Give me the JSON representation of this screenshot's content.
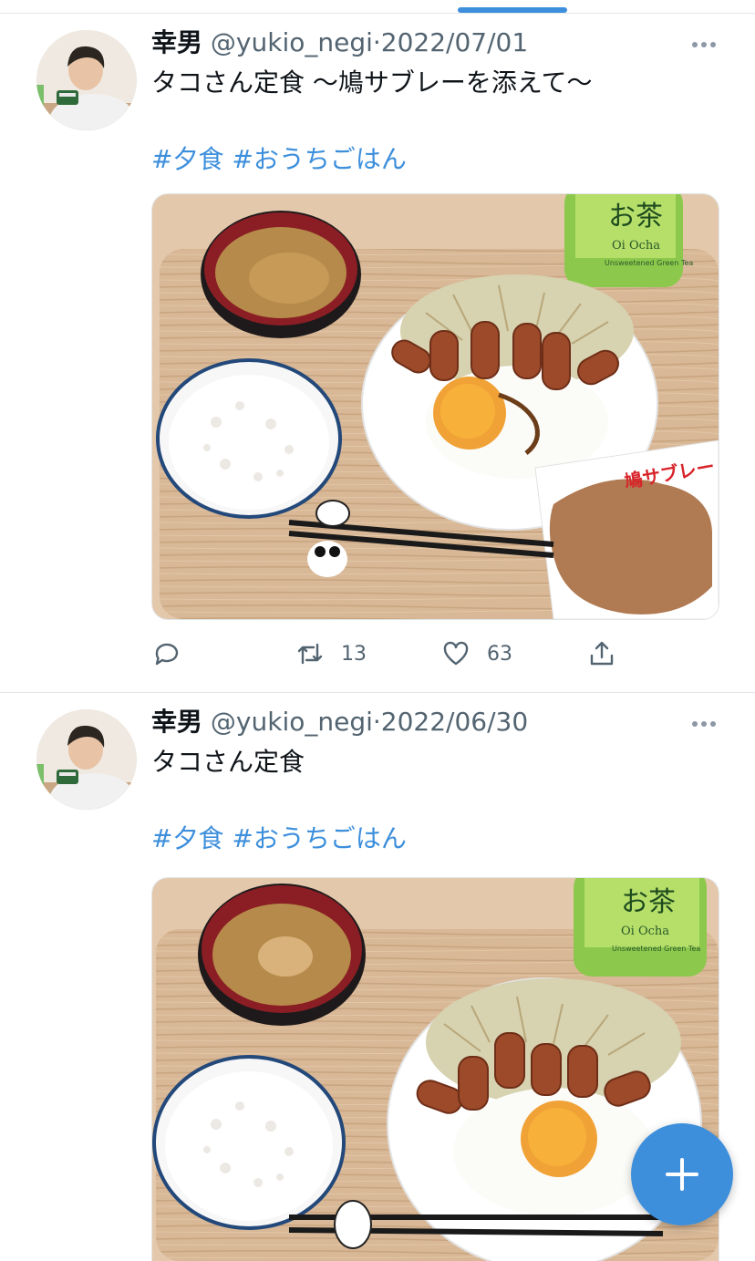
{
  "tweets": [
    {
      "name": "幸男",
      "handle": "@yukio_negi",
      "dot": "·",
      "date": "2022/07/01",
      "text": "タコさん定食 〜鳩サブレーを添えて〜",
      "tags": [
        "#夕食",
        "#おうちごはん"
      ],
      "media_labels": [
        "お茶",
        "Oi Ocha",
        "Unsweetened Green Tea",
        "鳩サブレー"
      ],
      "retweets": "13",
      "likes": "63"
    },
    {
      "name": "幸男",
      "handle": "@yukio_negi",
      "dot": "·",
      "date": "2022/06/30",
      "text": "タコさん定食",
      "tags": [
        "#夕食",
        "#おうちごはん"
      ],
      "media_labels": [
        "お茶",
        "Oi Ocha",
        "Unsweetened Green Tea"
      ]
    }
  ],
  "icons": {
    "more": "more-dots-icon",
    "reply": "reply-icon",
    "retweet": "retweet-icon",
    "like": "heart-icon",
    "share": "share-icon",
    "compose": "plus-icon"
  },
  "colors": {
    "accent": "#3d8fdc",
    "secondary_text": "#536471",
    "divider": "#e1e6ea"
  }
}
